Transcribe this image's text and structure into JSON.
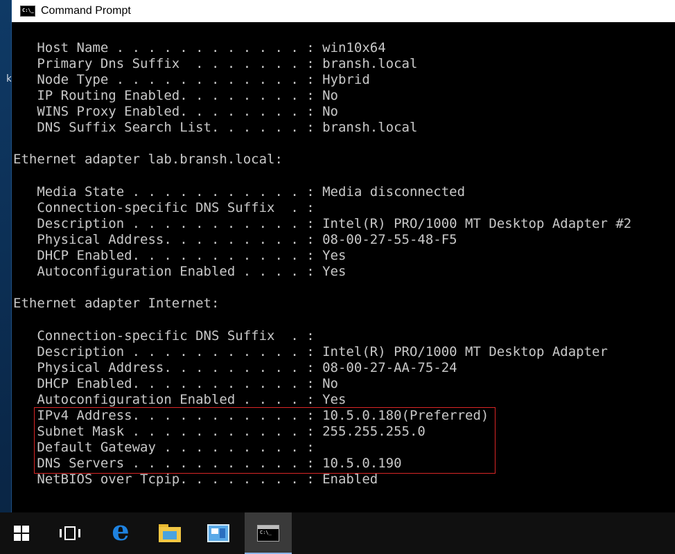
{
  "window": {
    "title": "Command Prompt"
  },
  "console": {
    "lines": [
      "",
      "   Host Name . . . . . . . . . . . . : win10x64",
      "   Primary Dns Suffix  . . . . . . . : bransh.local",
      "   Node Type . . . . . . . . . . . . : Hybrid",
      "   IP Routing Enabled. . . . . . . . : No",
      "   WINS Proxy Enabled. . . . . . . . : No",
      "   DNS Suffix Search List. . . . . . : bransh.local",
      "",
      "Ethernet adapter lab.bransh.local:",
      "",
      "   Media State . . . . . . . . . . . : Media disconnected",
      "   Connection-specific DNS Suffix  . :",
      "   Description . . . . . . . . . . . : Intel(R) PRO/1000 MT Desktop Adapter #2",
      "   Physical Address. . . . . . . . . : 08-00-27-55-48-F5",
      "   DHCP Enabled. . . . . . . . . . . : Yes",
      "   Autoconfiguration Enabled . . . . : Yes",
      "",
      "Ethernet adapter Internet:",
      "",
      "   Connection-specific DNS Suffix  . :",
      "   Description . . . . . . . . . . . : Intel(R) PRO/1000 MT Desktop Adapter",
      "   Physical Address. . . . . . . . . : 08-00-27-AA-75-24",
      "   DHCP Enabled. . . . . . . . . . . : No",
      "   Autoconfiguration Enabled . . . . : Yes",
      "   IPv4 Address. . . . . . . . . . . : 10.5.0.180(Preferred)",
      "   Subnet Mask . . . . . . . . . . . : 255.255.255.0",
      "   Default Gateway . . . . . . . . . :",
      "   DNS Servers . . . . . . . . . . . : 10.5.0.190",
      "   NetBIOS over Tcpip. . . . . . . . : Enabled"
    ]
  },
  "annotation": {
    "highlight_color": "#d92626"
  },
  "desktop": {
    "partial_glyph": "k"
  },
  "taskbar": {
    "icons": [
      "windows-start-icon",
      "task-view-icon",
      "edge-icon",
      "file-explorer-icon",
      "control-panel-icon",
      "command-prompt-icon"
    ],
    "edge_glyph": "e"
  }
}
